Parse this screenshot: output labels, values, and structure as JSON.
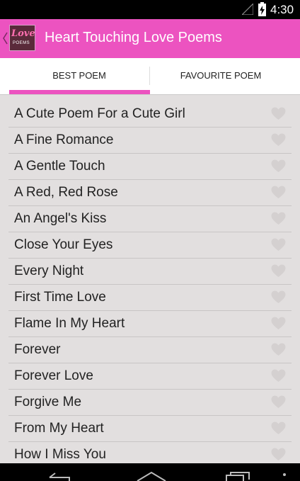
{
  "status_bar": {
    "time": "4:30",
    "icons": [
      "signal-icon",
      "battery-charging-icon"
    ]
  },
  "action_bar": {
    "title": "Heart Touching Love Poems",
    "logo_text": "Love",
    "logo_sub": "POEMS",
    "background_color": "#ec53c0"
  },
  "tabs": [
    {
      "label": "BEST POEM",
      "selected": true
    },
    {
      "label": "FAVOURITE POEM",
      "selected": false
    }
  ],
  "poems": [
    "A Cute Poem For a Cute Girl",
    "A Fine Romance",
    "A Gentle Touch",
    "A Red, Red Rose",
    "An Angel's Kiss",
    "Close Your Eyes",
    "Every Night",
    "First Time Love",
    "Flame In My Heart",
    "Forever",
    "Forever Love",
    "Forgive Me",
    "From My Heart",
    "How I Miss You"
  ],
  "colors": {
    "accent": "#ec53c0",
    "list_bg": "#e2dfdf",
    "heart": "#d4d0d0"
  }
}
